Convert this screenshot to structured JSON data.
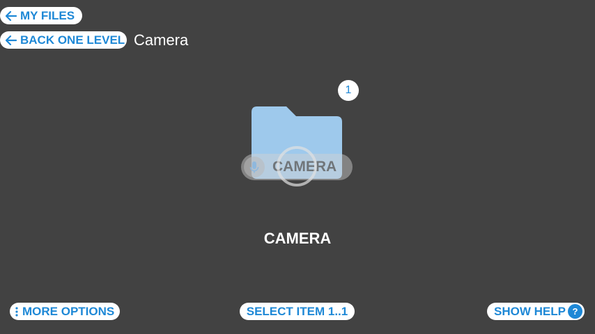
{
  "nav": {
    "my_files_label": "MY FILES",
    "back_label": "BACK ONE LEVEL",
    "path_title": "Camera"
  },
  "folder": {
    "icon": "folder-icon",
    "name": "CAMERA",
    "badge_count": "1",
    "voice_overlay_text": "CAMERA",
    "color": "#9ec9ec"
  },
  "footer": {
    "more_options_label": "MORE OPTIONS",
    "select_item_label": "SELECT ITEM 1..1",
    "show_help_label": "SHOW HELP",
    "help_icon_glyph": "?"
  },
  "colors": {
    "background": "#424242",
    "accent": "#1e88d6",
    "pill": "#ffffff"
  }
}
